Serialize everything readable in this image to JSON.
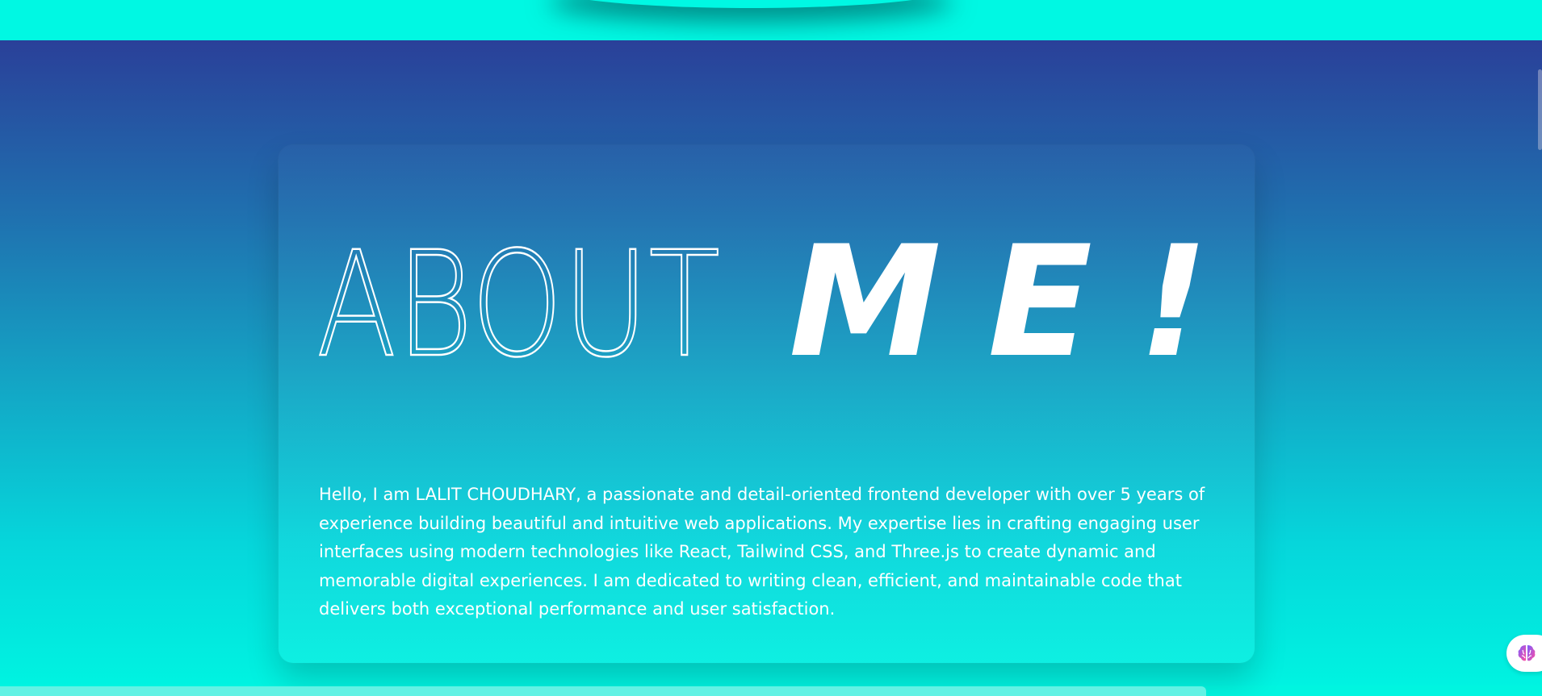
{
  "about": {
    "title_light": "ABOUT",
    "title_bold": "ME!",
    "paragraph": "Hello, I am LALIT CHOUDHARY, a passionate and detail-oriented frontend developer with over 5 years of experience building beautiful and intuitive web applications. My expertise lies in crafting engaging user interfaces using modern technologies like React, Tailwind CSS, and Three.js to create dynamic and memorable digital experiences. I am dedicated to writing clean, efficient, and maintainable code that delivers both exceptional performance and user satisfaction."
  },
  "widget": {
    "icon": "brain-icon"
  },
  "colors": {
    "accent": "#00f5e0",
    "hero_top": "#2a4099",
    "text": "#ffffff"
  }
}
